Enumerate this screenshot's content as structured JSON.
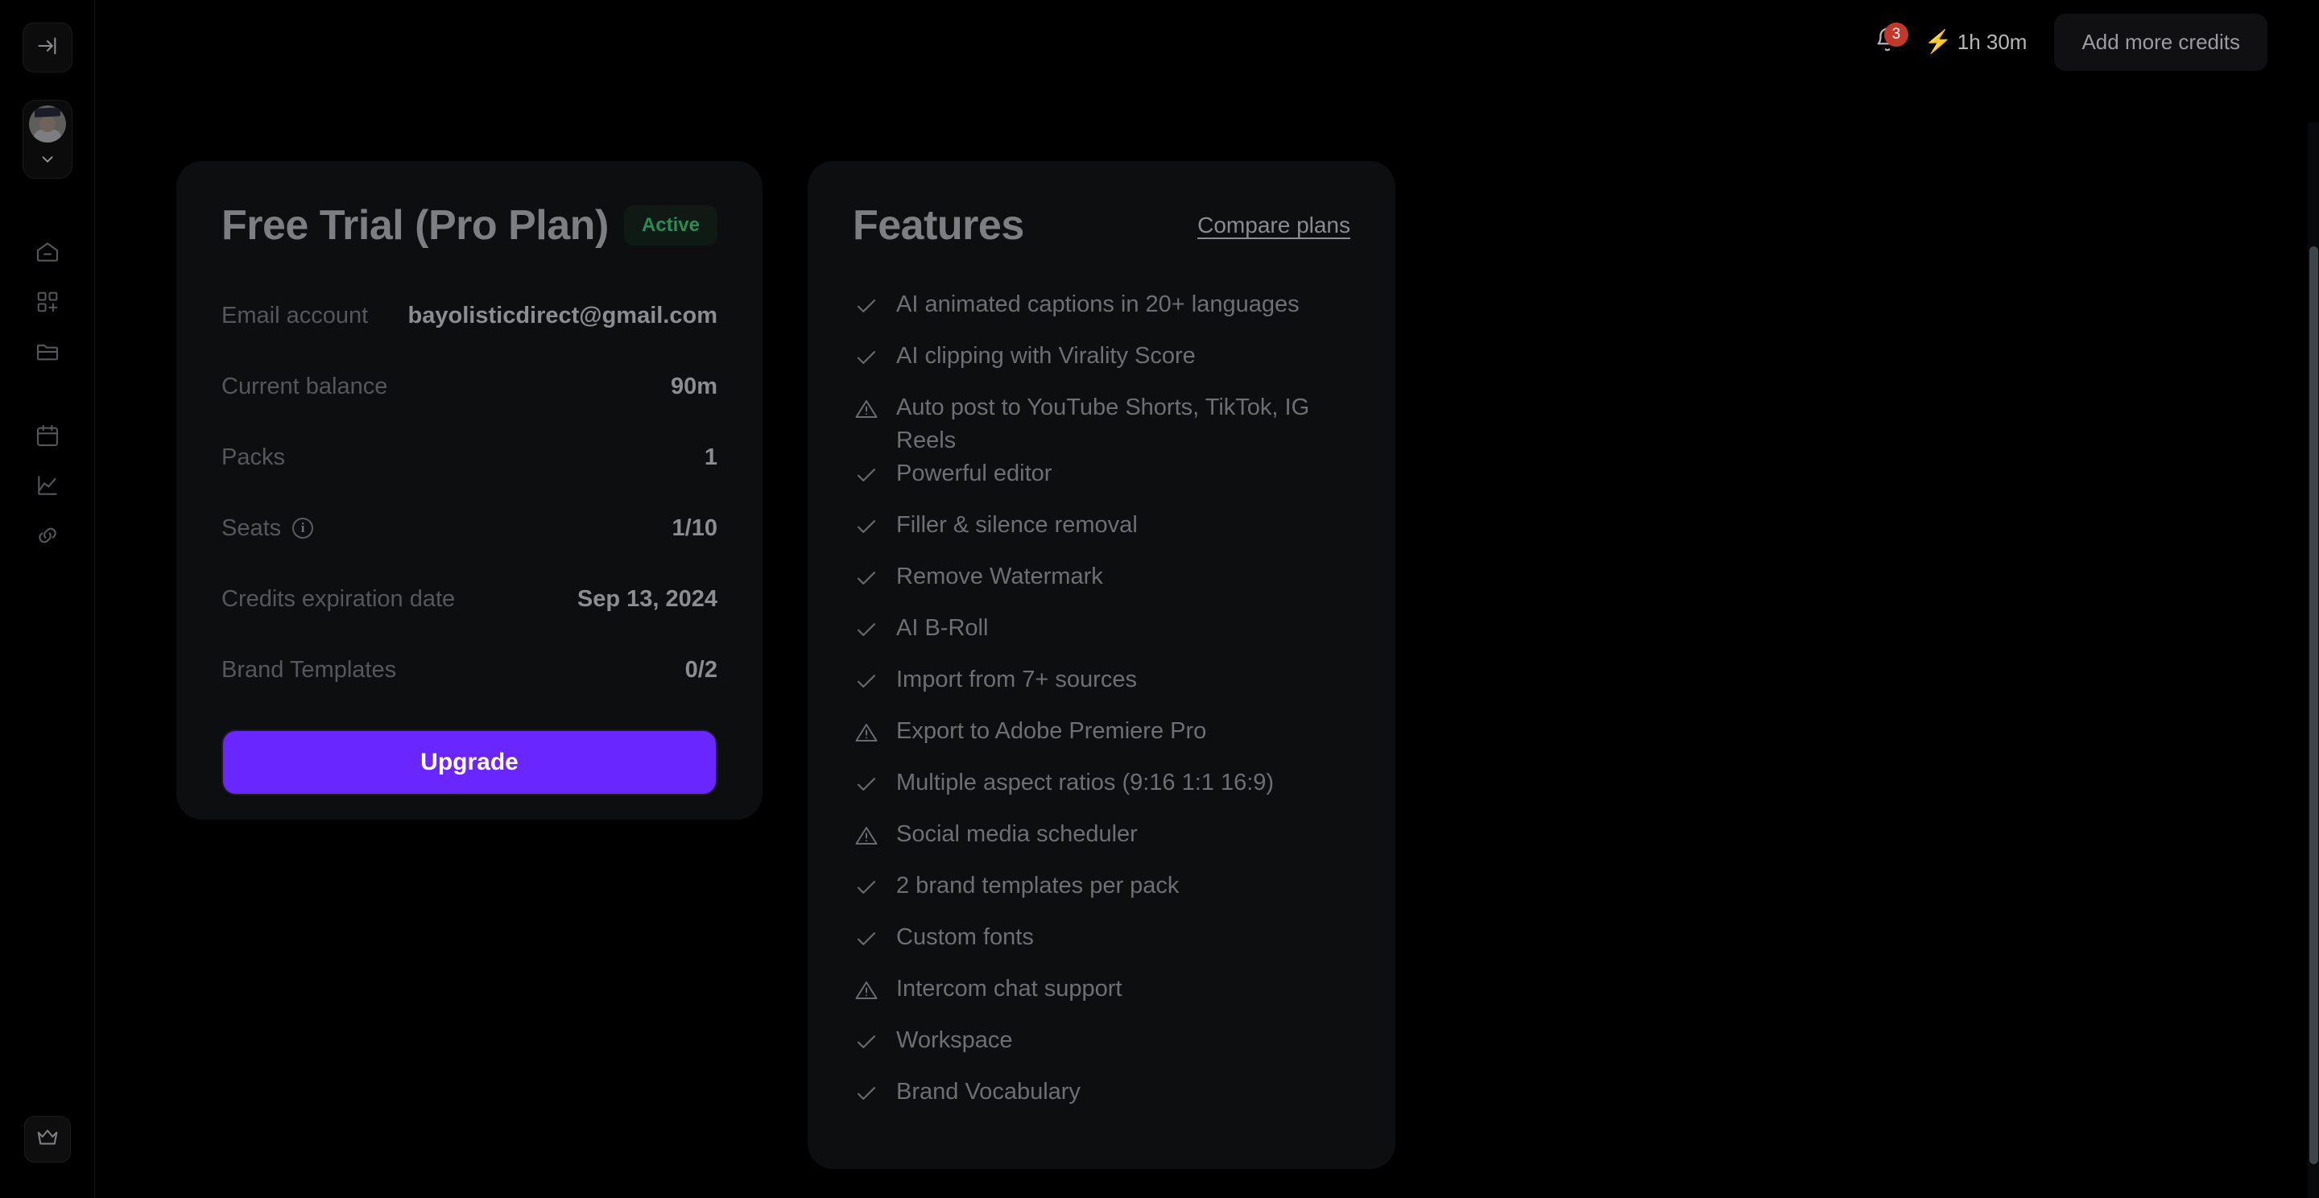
{
  "header": {
    "bell_icon": "bell-icon",
    "notification_count": "3",
    "bolt_icon": "bolt-icon",
    "credits_time": "1h 30m",
    "add_credits_label": "Add more credits"
  },
  "sidebar": {
    "collapse_icon": "collapse-panel-icon",
    "profile_chevron_icon": "chevron-down-icon",
    "crown_icon": "crown-icon",
    "items": [
      {
        "name": "sidebar-item-home",
        "icon": "home-icon"
      },
      {
        "name": "sidebar-item-create",
        "icon": "grid-plus-icon"
      },
      {
        "name": "sidebar-item-projects",
        "icon": "folder-icon"
      },
      {
        "name": "sidebar-item-schedule",
        "icon": "calendar-icon"
      },
      {
        "name": "sidebar-item-analytics",
        "icon": "chart-line-icon"
      },
      {
        "name": "sidebar-item-connections",
        "icon": "link-icon"
      }
    ]
  },
  "plan_card": {
    "title": "Free Trial (Pro Plan)",
    "status_badge": "Active",
    "badge_color": "#2a8b55",
    "rows": [
      {
        "label": "Email account",
        "value": "bayolisticdirect@gmail.com",
        "info": false
      },
      {
        "label": "Current balance",
        "value": "90m",
        "info": false
      },
      {
        "label": "Packs",
        "value": "1",
        "info": false
      },
      {
        "label": "Seats",
        "value": "1/10",
        "info": true
      },
      {
        "label": "Credits expiration date",
        "value": "Sep 13, 2024",
        "info": false
      },
      {
        "label": "Brand Templates",
        "value": "0/2",
        "info": false
      }
    ],
    "upgrade_label": "Upgrade",
    "upgrade_color": "#6a26ff"
  },
  "features_card": {
    "title": "Features",
    "compare_link": "Compare plans",
    "items": [
      {
        "text": "AI animated captions in 20+ languages",
        "icon": "check-icon"
      },
      {
        "text": "AI clipping with Virality Score",
        "icon": "check-icon"
      },
      {
        "text": "Auto post to YouTube Shorts, TikTok, IG Reels",
        "icon": "warning-icon"
      },
      {
        "text": "Powerful editor",
        "icon": "check-icon"
      },
      {
        "text": "Filler & silence removal",
        "icon": "check-icon"
      },
      {
        "text": "Remove Watermark",
        "icon": "check-icon"
      },
      {
        "text": "AI B-Roll",
        "icon": "check-icon"
      },
      {
        "text": "Import from 7+ sources",
        "icon": "check-icon"
      },
      {
        "text": "Export to Adobe Premiere Pro",
        "icon": "warning-icon"
      },
      {
        "text": "Multiple aspect ratios (9:16 1:1 16:9)",
        "icon": "check-icon"
      },
      {
        "text": "Social media scheduler",
        "icon": "warning-icon"
      },
      {
        "text": "2 brand templates per pack",
        "icon": "check-icon"
      },
      {
        "text": "Custom fonts",
        "icon": "check-icon"
      },
      {
        "text": "Intercom chat support",
        "icon": "warning-icon"
      },
      {
        "text": "Workspace",
        "icon": "check-icon"
      },
      {
        "text": "Brand Vocabulary",
        "icon": "check-icon"
      }
    ]
  }
}
